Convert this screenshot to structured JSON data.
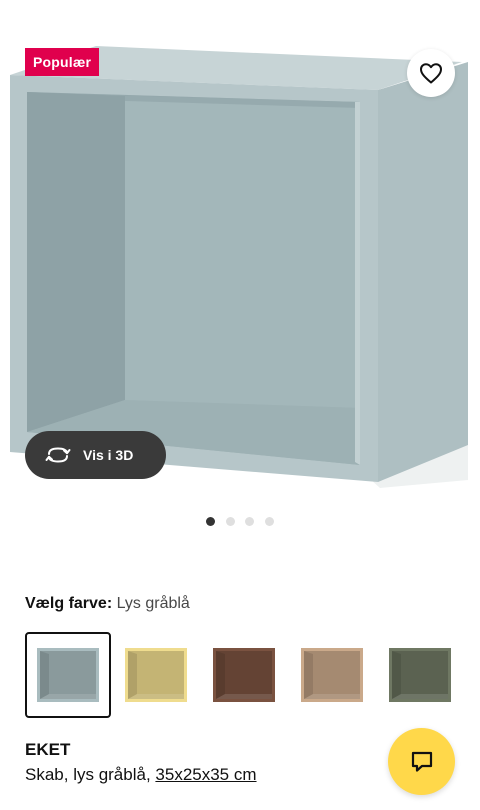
{
  "product": {
    "badge": "Populær",
    "name": "EKET",
    "description_prefix": "Skab, lys gråblå, ",
    "dimensions": "35x25x35 cm",
    "view_3d_label": "Vis i 3D"
  },
  "gallery": {
    "image_count": 4,
    "active_index": 0
  },
  "color_picker": {
    "label": "Vælg farve:",
    "selected_value": "Lys gråblå",
    "options": [
      {
        "name": "Lys gråblå",
        "color": "#a9bcbf",
        "selected": true
      },
      {
        "name": "Lys gul",
        "color": "#efdc8e",
        "selected": false
      },
      {
        "name": "Valnøddemønster",
        "color": "#7a5240",
        "selected": false
      },
      {
        "name": "Hvidpigmenteret egemønster",
        "color": "#caa98a",
        "selected": false
      },
      {
        "name": "Grågrøn",
        "color": "#6f7863",
        "selected": false
      }
    ]
  },
  "icons": {
    "favorite": "heart-icon",
    "view_3d": "rotate-3d-icon",
    "chat": "chat-icon"
  },
  "colors": {
    "badge": "#e0004d",
    "chat_button": "#ffd84a",
    "view_3d_button": "#3a3a3a"
  }
}
